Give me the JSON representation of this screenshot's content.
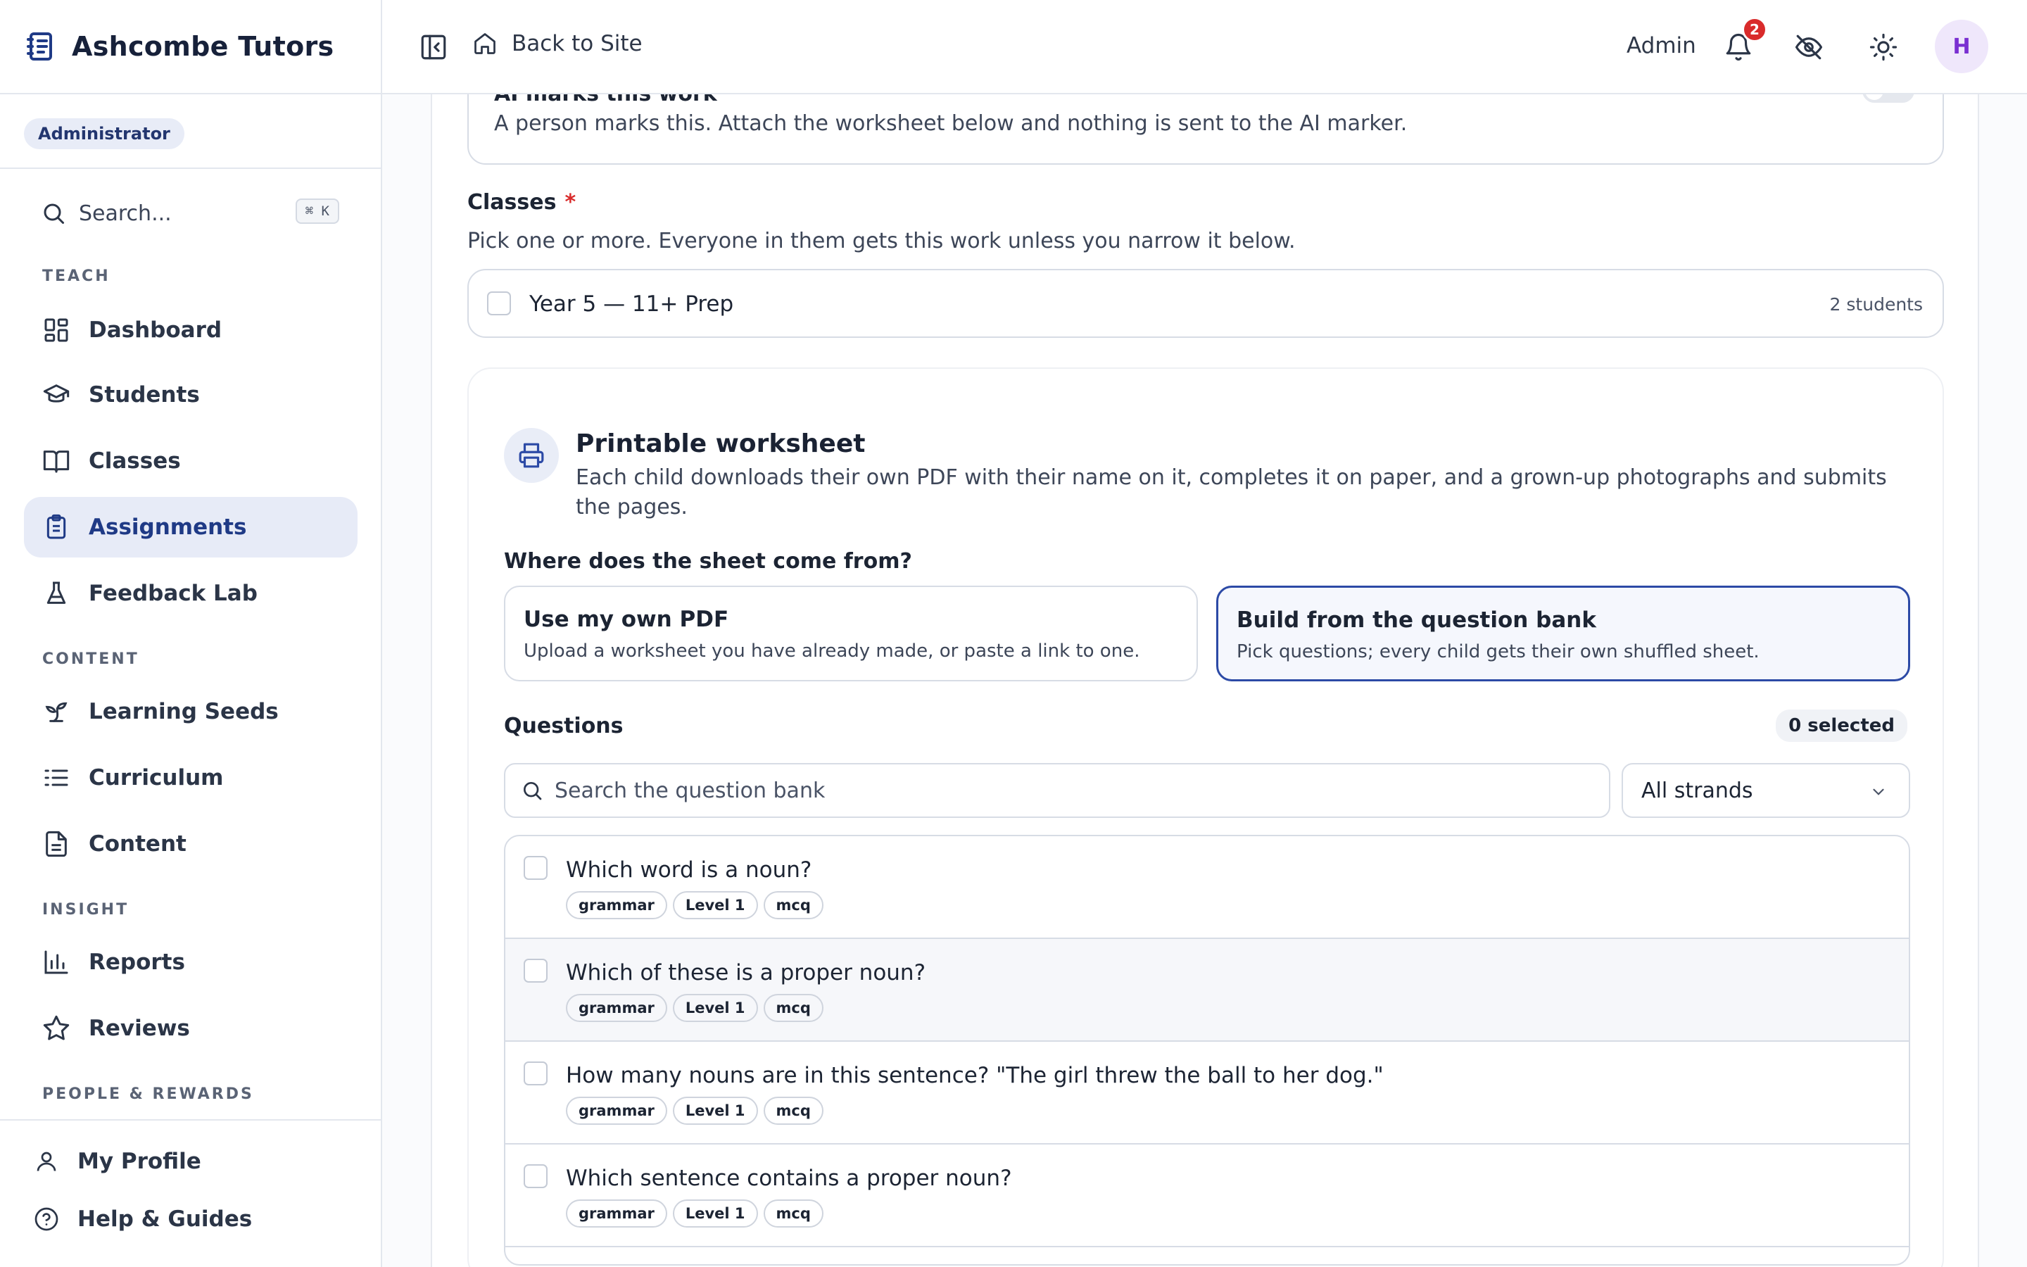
{
  "app": {
    "name": "Ashcombe Tutors",
    "role": "Administrator"
  },
  "sidebar": {
    "search_label": "Search...",
    "search_shortcut": "⌘ K",
    "sections": {
      "teach": "TEACH",
      "content": "CONTENT",
      "insight": "INSIGHT",
      "people": "PEOPLE & REWARDS"
    },
    "items": [
      {
        "label": "Dashboard",
        "icon": "dashboard-icon"
      },
      {
        "label": "Students",
        "icon": "graduation-cap-icon"
      },
      {
        "label": "Classes",
        "icon": "book-open-icon"
      },
      {
        "label": "Assignments",
        "icon": "clipboard-icon",
        "active": true
      },
      {
        "label": "Feedback Lab",
        "icon": "flask-icon"
      },
      {
        "label": "Learning Seeds",
        "icon": "sprout-icon"
      },
      {
        "label": "Curriculum",
        "icon": "list-icon"
      },
      {
        "label": "Content",
        "icon": "file-text-icon"
      },
      {
        "label": "Reports",
        "icon": "bar-chart-icon"
      },
      {
        "label": "Reviews",
        "icon": "star-icon"
      }
    ],
    "footer": [
      {
        "label": "My Profile",
        "icon": "user-icon"
      },
      {
        "label": "Help & Guides",
        "icon": "help-circle-icon"
      }
    ]
  },
  "topbar": {
    "back_label": "Back to Site",
    "admin_label": "Admin",
    "notification_count": "2",
    "avatar_initial": "H"
  },
  "ai_marking": {
    "title": "AI marks this work",
    "description": "A person marks this. Attach the worksheet below and nothing is sent to the AI marker."
  },
  "classes": {
    "label": "Classes",
    "required_mark": "*",
    "help": "Pick one or more. Everyone in them gets this work unless you narrow it below.",
    "items": [
      {
        "name": "Year 5 — 11+ Prep",
        "count": "2 students"
      }
    ]
  },
  "worksheet": {
    "title": "Printable worksheet",
    "description": "Each child downloads their own PDF with their name on it, completes it on paper, and a grown-up photographs and submits the pages.",
    "source_question": "Where does the sheet come from?",
    "options": [
      {
        "title": "Use my own PDF",
        "description": "Upload a worksheet you have already made, or paste a link to one."
      },
      {
        "title": "Build from the question bank",
        "description": "Pick questions; every child gets their own shuffled sheet.",
        "selected": true
      }
    ],
    "questions_label": "Questions",
    "selected_count": "0 selected",
    "search_placeholder": "Search the question bank",
    "strand_filter": "All strands",
    "questions": [
      {
        "text": "Which word is a noun?",
        "tags": [
          "grammar",
          "Level 1",
          "mcq"
        ]
      },
      {
        "text": "Which of these is a proper noun?",
        "tags": [
          "grammar",
          "Level 1",
          "mcq"
        ]
      },
      {
        "text": "How many nouns are in this sentence? \"The girl threw the ball to her dog.\"",
        "tags": [
          "grammar",
          "Level 1",
          "mcq"
        ]
      },
      {
        "text": "Which sentence contains a proper noun?",
        "tags": [
          "grammar",
          "Level 1",
          "mcq"
        ]
      }
    ]
  },
  "colors": {
    "accent": "#2c4aa6",
    "active_nav_bg": "#e7ebf7",
    "badge_red": "#d92b2b",
    "avatar_purple": "#7a2fd1"
  }
}
